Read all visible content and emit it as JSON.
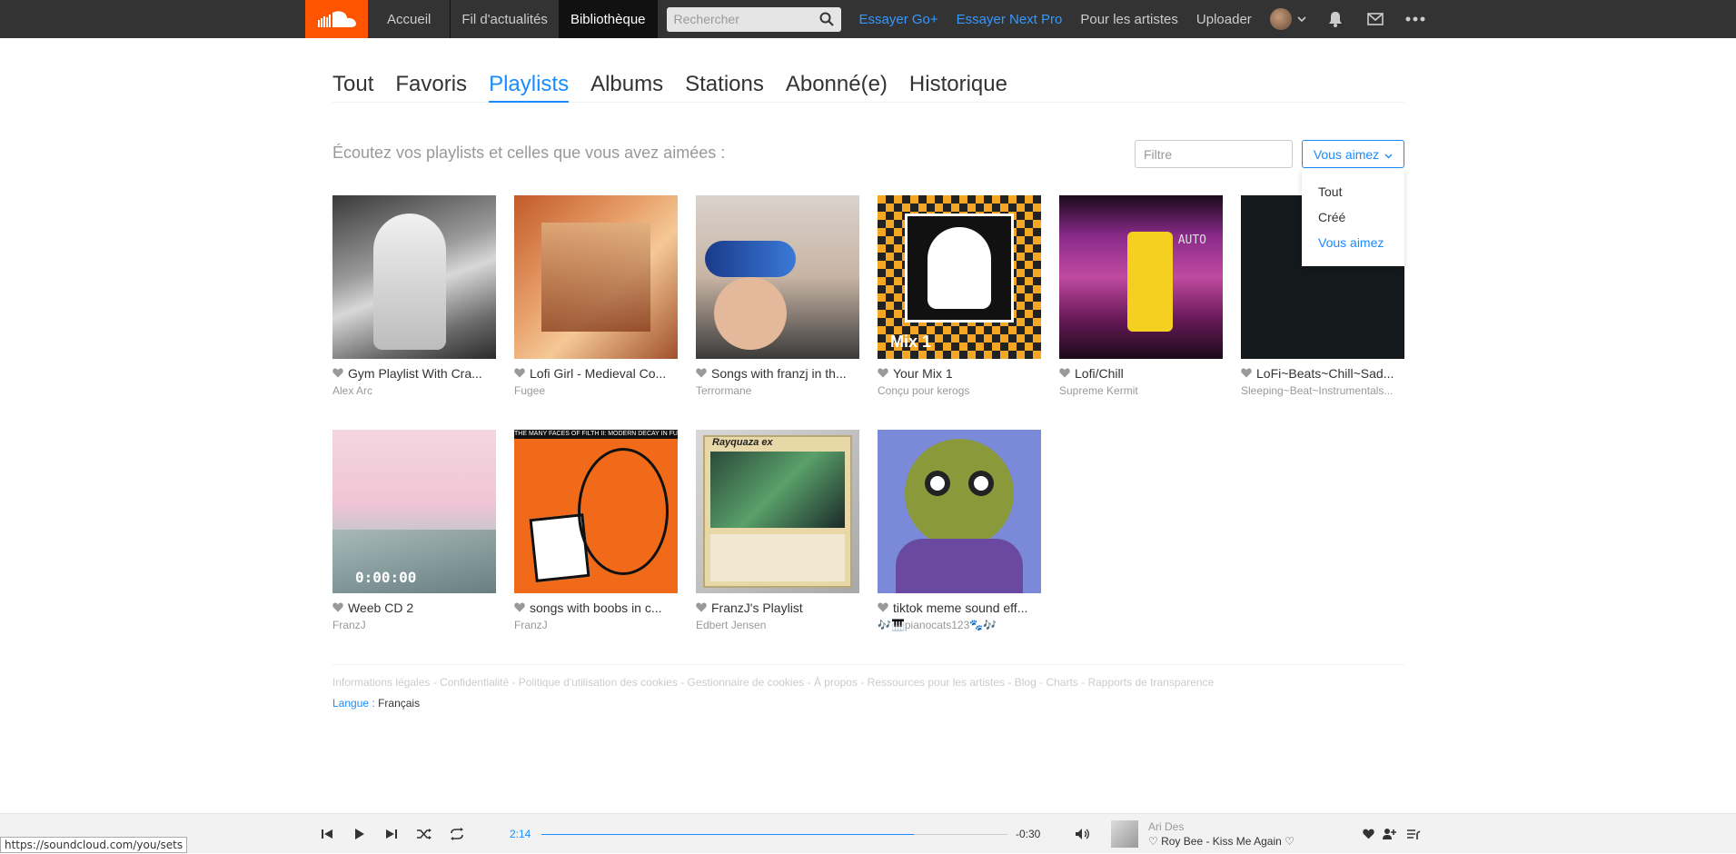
{
  "header": {
    "nav": [
      "Accueil",
      "Fil d'actualités",
      "Bibliothèque"
    ],
    "search_placeholder": "Rechercher",
    "links": [
      "Essayer Go+",
      "Essayer Next Pro",
      "Pour les artistes",
      "Uploader"
    ]
  },
  "tabs": [
    "Tout",
    "Favoris",
    "Playlists",
    "Albums",
    "Stations",
    "Abonné(e)",
    "Historique"
  ],
  "subtitle": "Écoutez vos playlists et celles que vous avez aimées :",
  "filter_placeholder": "Filtre",
  "dropdown": {
    "selected": "Vous aimez",
    "options": [
      "Tout",
      "Créé",
      "Vous aimez"
    ]
  },
  "playlists": [
    {
      "title": "Gym Playlist With Cra...",
      "author": "Alex Arc"
    },
    {
      "title": "Lofi Girl - Medieval Co...",
      "author": "Fugee"
    },
    {
      "title": "Songs with franzj in th...",
      "author": "Terrormane"
    },
    {
      "title": "Your Mix 1",
      "author": "Conçu pour kerogs",
      "cover_text": "Mix 1"
    },
    {
      "title": "Lofi/Chill",
      "author": "Supreme Kermit",
      "cover_text": "AUTO"
    },
    {
      "title": "LoFi~Beats~Chill~Sad...",
      "author": "Sleeping~Beat~Instrumentals..."
    },
    {
      "title": "Weeb CD 2",
      "author": "FranzJ",
      "cover_text": "0:00:00"
    },
    {
      "title": "songs with boobs in c...",
      "author": "FranzJ",
      "cover_text": "THE MANY FACES OF FILTH II: MODERN DECAY IN FULL MOTION"
    },
    {
      "title": "FranzJ's Playlist",
      "author": "Edbert Jensen",
      "cover_text": "Rayquaza ex"
    },
    {
      "title": "tiktok meme sound eff...",
      "author": "🎶🎹pianocats123🐾🎶"
    }
  ],
  "footer": {
    "links": [
      "Informations légales",
      "Confidentialité",
      "Politique d'utilisation des cookies",
      "Gestionnaire de cookies",
      "À propos",
      "Ressources pour les artistes",
      "Blog",
      "Charts",
      "Rapports de transparence"
    ],
    "lang_label": "Langue :",
    "lang_value": "Français"
  },
  "player": {
    "current_time": "2:14",
    "remaining_time": "-0:30",
    "progress": 0.8,
    "artist": "Ari Des",
    "track": "♡ Roy Bee - Kiss Me Again ♡"
  },
  "status_url": "https://soundcloud.com/you/sets"
}
